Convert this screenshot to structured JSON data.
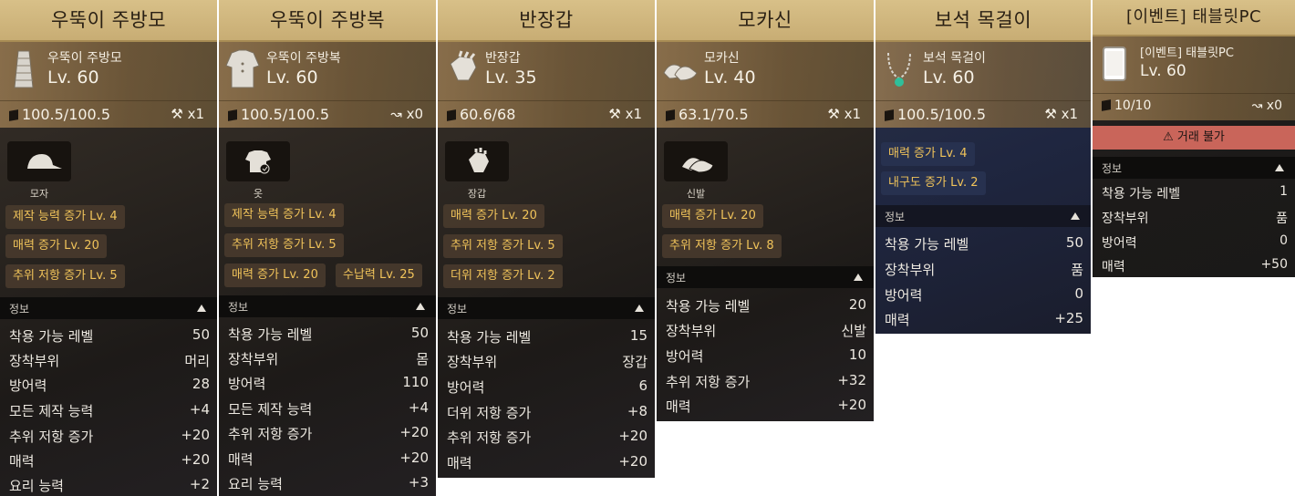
{
  "cards": [
    {
      "title": "우뚝이 주방모",
      "name": "우뚝이 주방모",
      "level": "Lv. 60",
      "durability": "100.5/100.5",
      "modifier": "x1",
      "slot": "모자",
      "buffs": [
        "제작 능력 증가 Lv. 4",
        "매력 증가 Lv. 20",
        "추위 저항 증가 Lv. 5"
      ],
      "info_label": "정보",
      "stats": [
        {
          "k": "착용 가능 레벨",
          "v": "50"
        },
        {
          "k": "장착부위",
          "v": "머리"
        },
        {
          "k": "방어력",
          "v": "28"
        },
        {
          "k": "모든 제작 능력",
          "v": "+4"
        },
        {
          "k": "추위 저항 증가",
          "v": "+20"
        },
        {
          "k": "매력",
          "v": "+20"
        },
        {
          "k": "요리 능력",
          "v": "+2"
        }
      ]
    },
    {
      "title": "우뚝이 주방복",
      "name": "우뚝이 주방복",
      "level": "Lv. 60",
      "durability": "100.5/100.5",
      "modifier": "x0",
      "slot": "옷",
      "buffs": [
        "제작 능력 증가 Lv. 4",
        "추위 저항 증가 Lv. 5",
        "매력 증가 Lv. 20",
        "수납력 Lv. 25"
      ],
      "info_label": "정보",
      "stats": [
        {
          "k": "착용 가능 레벨",
          "v": "50"
        },
        {
          "k": "장착부위",
          "v": "몸"
        },
        {
          "k": "방어력",
          "v": "110"
        },
        {
          "k": "모든 제작 능력",
          "v": "+4"
        },
        {
          "k": "추위 저항 증가",
          "v": "+20"
        },
        {
          "k": "매력",
          "v": "+20"
        },
        {
          "k": "요리 능력",
          "v": "+3"
        }
      ]
    },
    {
      "title": "반장갑",
      "name": "반장갑",
      "level": "Lv. 35",
      "durability": "60.6/68",
      "modifier": "x1",
      "slot": "장갑",
      "buffs": [
        "매력 증가 Lv. 20",
        "추위 저항 증가 Lv. 5",
        "더위 저항 증가 Lv. 2"
      ],
      "info_label": "정보",
      "stats": [
        {
          "k": "착용 가능 레벨",
          "v": "15"
        },
        {
          "k": "장착부위",
          "v": "장갑"
        },
        {
          "k": "방어력",
          "v": "6"
        },
        {
          "k": "더위 저항 증가",
          "v": "+8"
        },
        {
          "k": "추위 저항 증가",
          "v": "+20"
        },
        {
          "k": "매력",
          "v": "+20"
        }
      ]
    },
    {
      "title": "모카신",
      "name": "모카신",
      "level": "Lv. 40",
      "durability": "63.1/70.5",
      "modifier": "x1",
      "slot": "신발",
      "buffs": [
        "매력 증가 Lv. 20",
        "추위 저항 증가 Lv. 8"
      ],
      "info_label": "정보",
      "stats": [
        {
          "k": "착용 가능 레벨",
          "v": "20"
        },
        {
          "k": "장착부위",
          "v": "신발"
        },
        {
          "k": "방어력",
          "v": "10"
        },
        {
          "k": "추위 저항 증가",
          "v": "+32"
        },
        {
          "k": "매력",
          "v": "+20"
        }
      ]
    },
    {
      "title": "보석 목걸이",
      "name": "보석 목걸이",
      "level": "Lv. 60",
      "durability": "100.5/100.5",
      "modifier": "x1",
      "buffs": [
        "매력 증가 Lv. 4",
        "내구도 증가 Lv. 2"
      ],
      "info_label": "정보",
      "stats": [
        {
          "k": "착용 가능 레벨",
          "v": "50"
        },
        {
          "k": "장착부위",
          "v": "품"
        },
        {
          "k": "방어력",
          "v": "0"
        },
        {
          "k": "매력",
          "v": "+25"
        }
      ]
    },
    {
      "title": "[이벤트] 태블릿PC",
      "name": "[이벤트] 태블릿PC",
      "level": "Lv. 60",
      "durability": "10/10",
      "modifier": "x0",
      "trade_warning": "거래 불가",
      "info_label": "정보",
      "stats": [
        {
          "k": "착용 가능 레벨",
          "v": "1"
        },
        {
          "k": "장착부위",
          "v": "품"
        },
        {
          "k": "방어력",
          "v": "0"
        },
        {
          "k": "매력",
          "v": "+50"
        }
      ]
    }
  ],
  "colors": {
    "title_bar": "#d2b880",
    "buff_text": "#f0c35a",
    "trade_warning_bg": "#c9655a"
  }
}
